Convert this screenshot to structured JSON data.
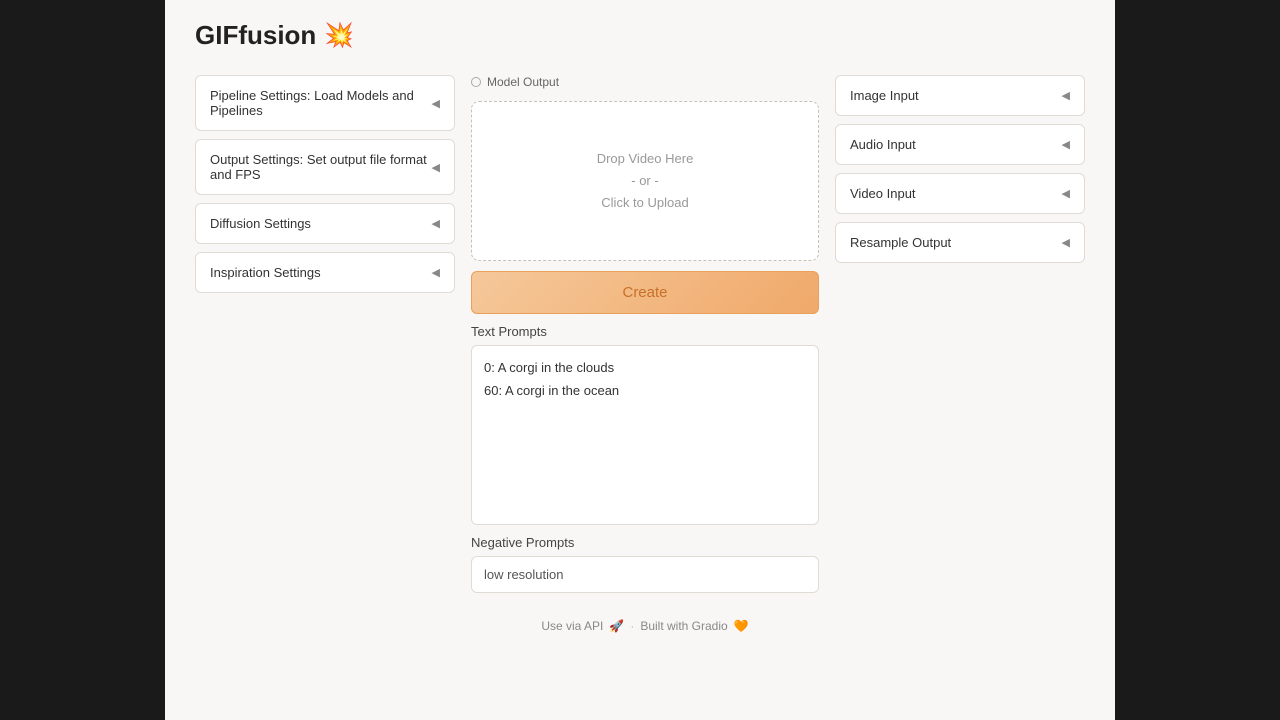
{
  "app": {
    "title": "GIFfusion",
    "icon": "💥"
  },
  "left_sidebar": {
    "items": [
      {
        "id": "pipeline",
        "label": "Pipeline Settings: Load Models and Pipelines"
      },
      {
        "id": "output",
        "label": "Output Settings: Set output file format and FPS"
      },
      {
        "id": "diffusion",
        "label": "Diffusion Settings"
      },
      {
        "id": "inspiration",
        "label": "Inspiration Settings"
      }
    ]
  },
  "center": {
    "model_output_label": "Model Output",
    "video_upload": {
      "line1": "Drop Video Here",
      "line2": "- or -",
      "line3": "Click to Upload"
    },
    "create_button_label": "Create",
    "text_prompts_label": "Text Prompts",
    "text_prompts_lines": [
      "0: A corgi in the clouds",
      "60: A corgi in the ocean"
    ],
    "negative_prompts_label": "Negative Prompts",
    "negative_prompts_value": "low resolution"
  },
  "right_sidebar": {
    "items": [
      {
        "id": "image-input",
        "label": "Image Input"
      },
      {
        "id": "audio-input",
        "label": "Audio Input"
      },
      {
        "id": "video-input",
        "label": "Video Input"
      },
      {
        "id": "resample-output",
        "label": "Resample Output"
      }
    ]
  },
  "footer": {
    "api_label": "Use via API",
    "api_icon": "🚀",
    "built_label": "Built with Gradio",
    "built_icon": "🧡",
    "separator": "·"
  }
}
